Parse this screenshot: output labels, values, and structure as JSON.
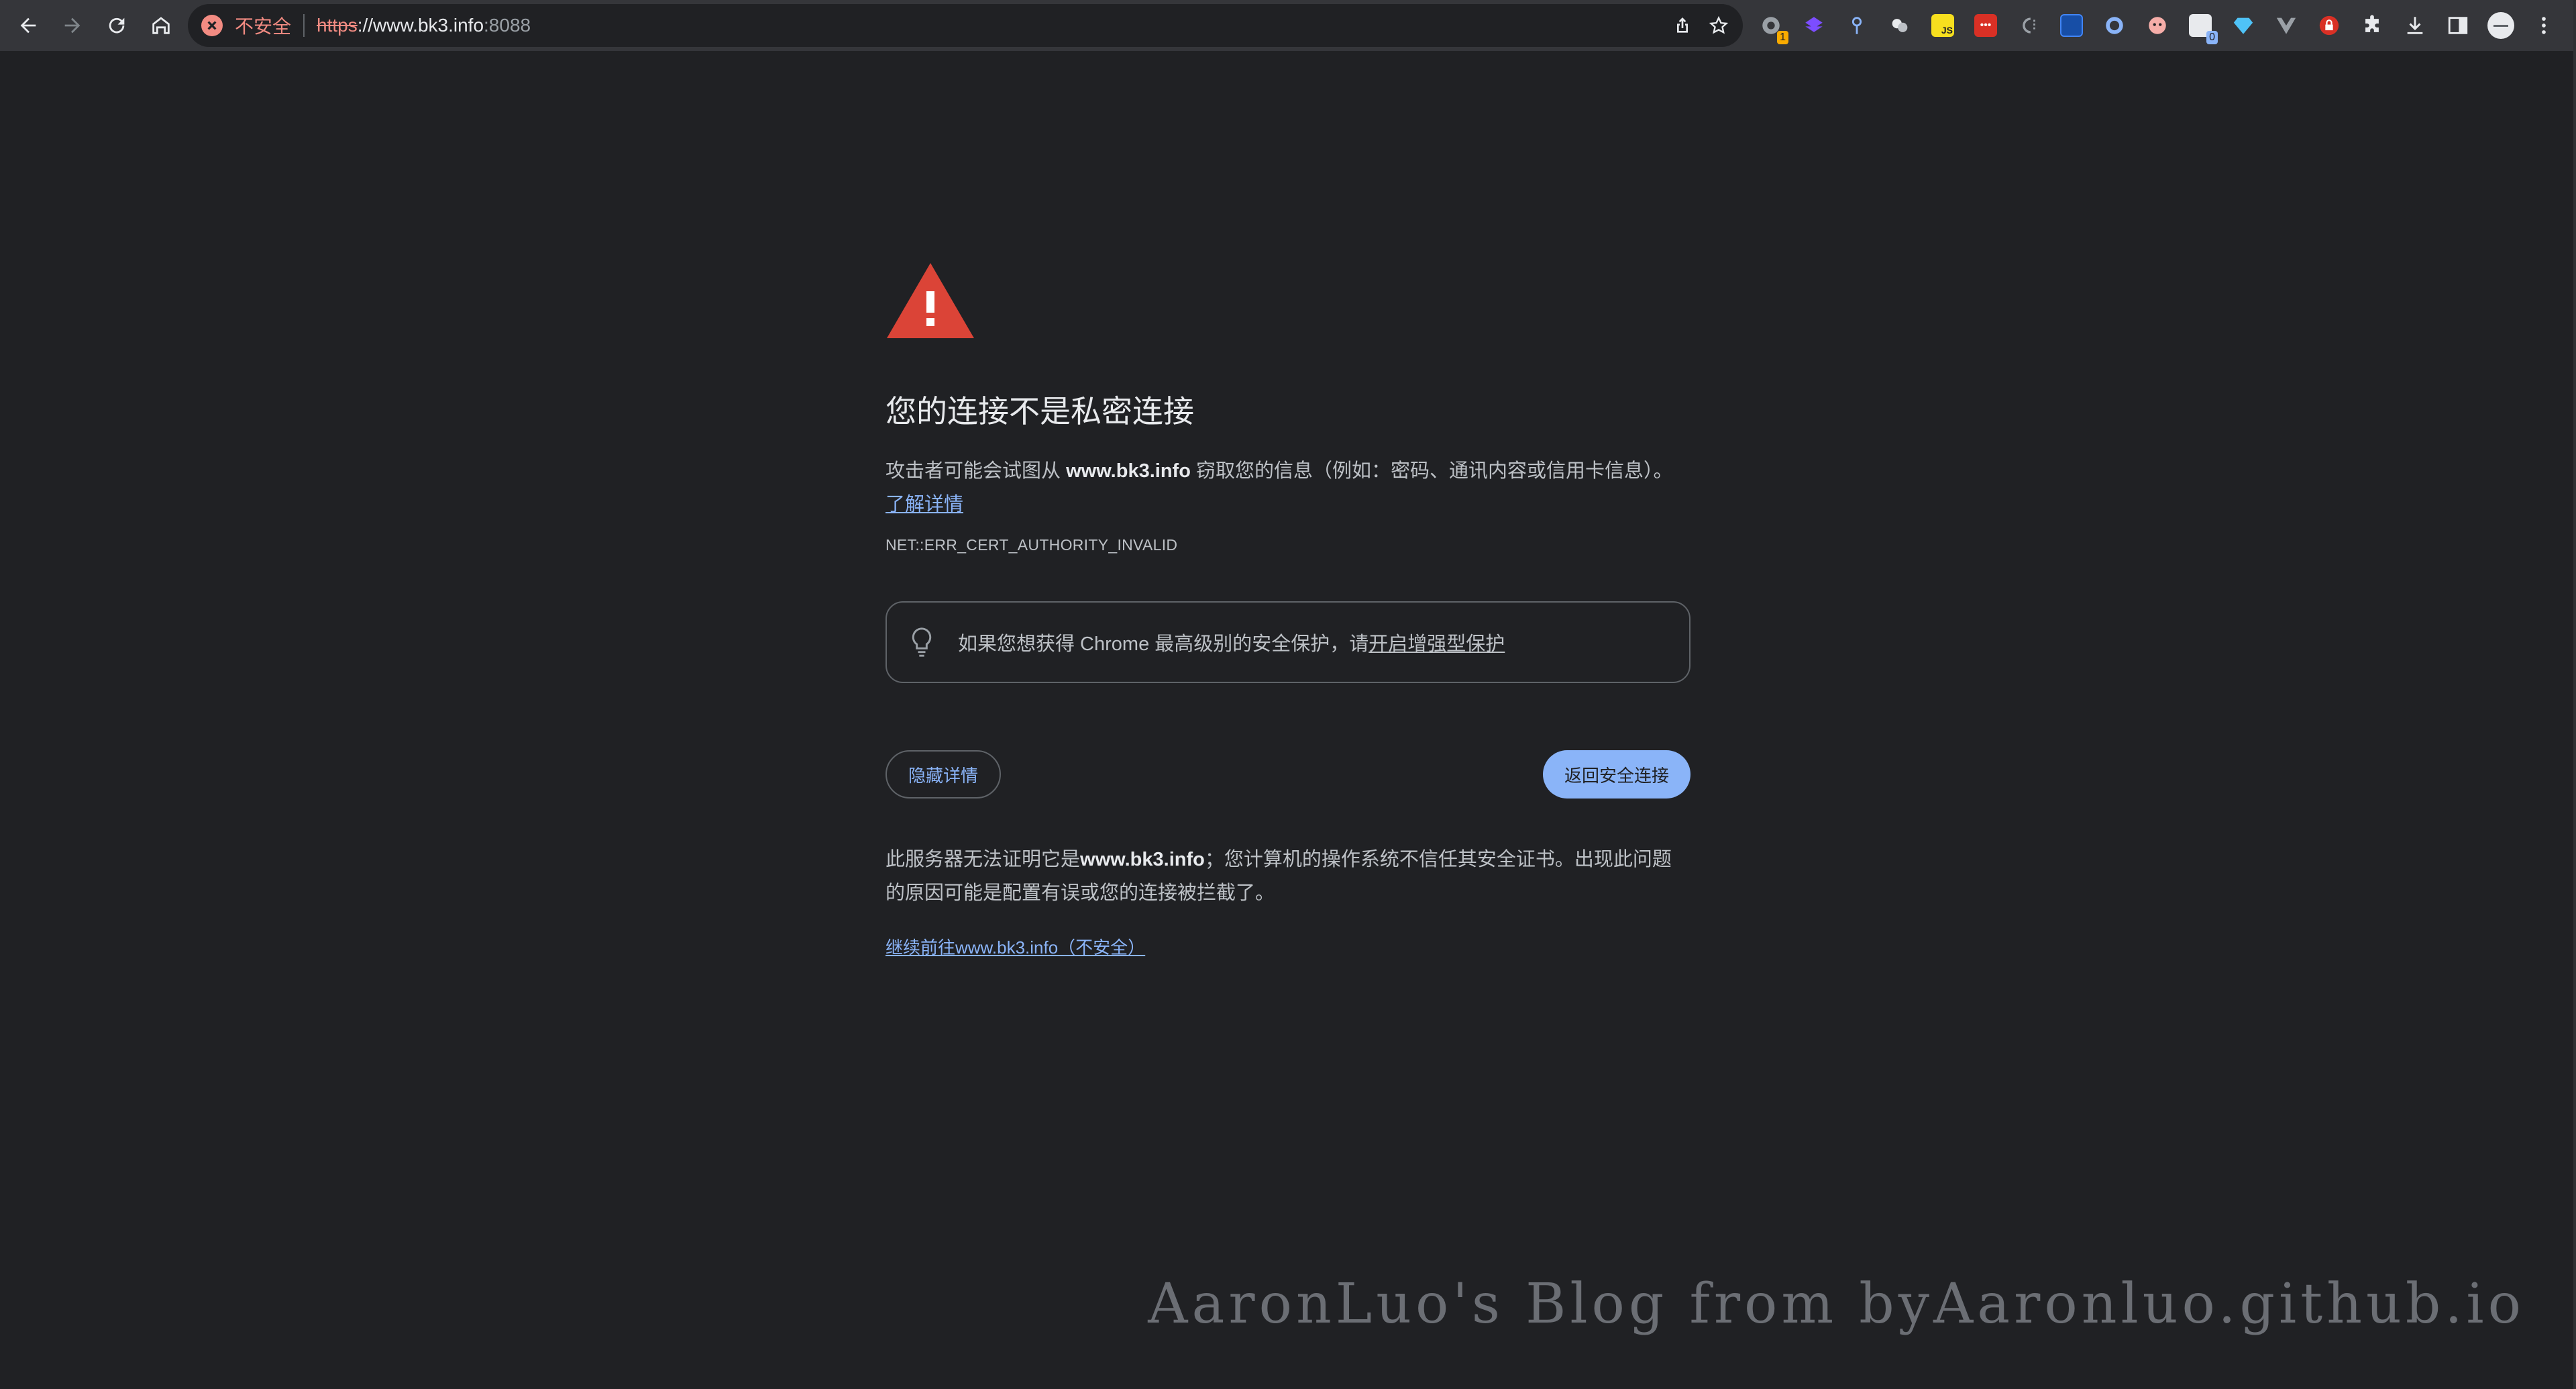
{
  "browser": {
    "security_label": "不安全",
    "url": {
      "scheme": "https",
      "rest": "://www.bk3.info",
      "port": ":8088"
    },
    "extensions": [
      {
        "icon": "github-icon",
        "color": "#9aa0a6",
        "badge": "1",
        "badge_color": "#f9ab00"
      },
      {
        "icon": "layers-icon",
        "color": "#7c4dff"
      },
      {
        "icon": "pin-icon",
        "color": "#8ab4f8"
      },
      {
        "icon": "chat-icon",
        "color": "#e8eaed"
      },
      {
        "icon": "js-icon",
        "color": "#f7df1e"
      },
      {
        "icon": "password-icon",
        "color": "#d93025"
      },
      {
        "icon": "code-icon",
        "color": "#9aa0a6"
      },
      {
        "icon": "translate-icon",
        "color": "#1a73e8"
      },
      {
        "icon": "circle-icon",
        "color": "#8ab4f8"
      },
      {
        "icon": "face-icon",
        "color": "#f6aea9"
      },
      {
        "icon": "screenshot-icon",
        "color": "#e8eaed",
        "badge": "0",
        "badge_color": "#8ab4f8"
      },
      {
        "icon": "gem-icon",
        "color": "#4fc3f7"
      },
      {
        "icon": "vue-icon",
        "color": "#9aa0a6"
      },
      {
        "icon": "lock-icon",
        "color": "#d93025"
      },
      {
        "icon": "puzzle-icon",
        "color": "#e8eaed"
      },
      {
        "icon": "download-icon",
        "color": "#e8eaed"
      },
      {
        "icon": "sidepanel-icon",
        "color": "#e8eaed"
      }
    ]
  },
  "interstitial": {
    "heading": "您的连接不是私密连接",
    "para_prefix": "攻击者可能会试图从",
    "para_host": "www.bk3.info",
    "para_suffix": "窃取您的信息（例如：密码、通讯内容或信用卡信息）。",
    "learn_more": "了解详情",
    "error_code": "NET::ERR_CERT_AUTHORITY_INVALID",
    "enhanced_prefix": "如果您想获得 Chrome 最高级别的安全保护，请",
    "enhanced_link": "开启增强型保护",
    "hide_details": "隐藏详情",
    "back_to_safety": "返回安全连接",
    "details_prefix": "此服务器无法证明它是",
    "details_host": "www.bk3.info",
    "details_suffix": "；您计算机的操作系统不信任其安全证书。出现此问题的原因可能是配置有误或您的连接被拦截了。",
    "proceed_link": "继续前往www.bk3.info（不安全）"
  },
  "watermark": "AaronLuo's Blog from byAaronluo.github.io",
  "colors": {
    "background": "#202124",
    "toolbar": "#35363a",
    "warning_red": "#db4437",
    "link_blue": "#8ab4f8",
    "insecure_red": "#f28b82"
  }
}
